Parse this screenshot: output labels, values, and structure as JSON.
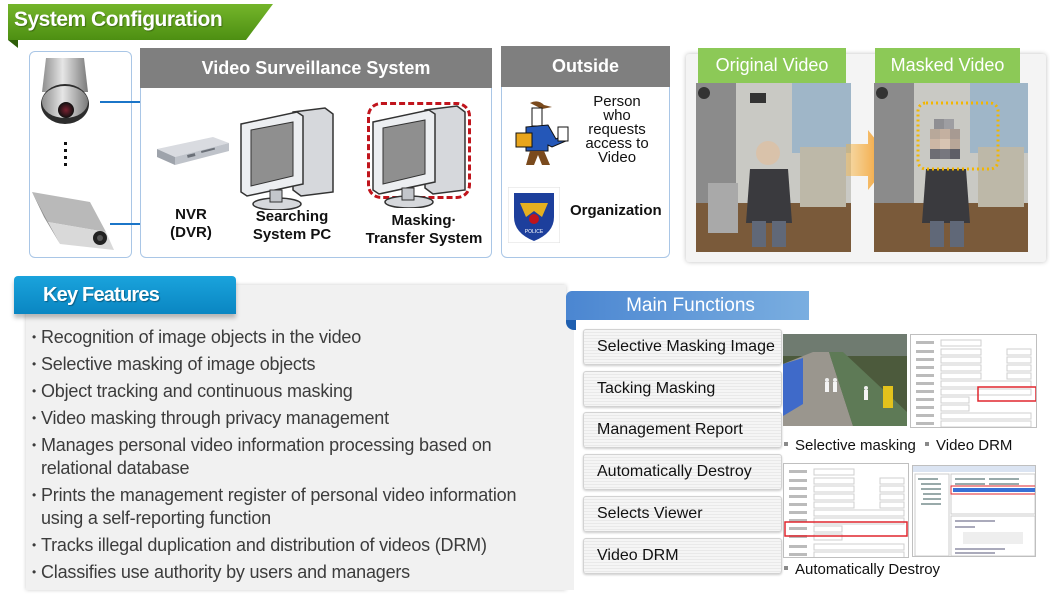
{
  "system_configuration": {
    "title": "System Configuration",
    "video_surveillance_system": {
      "header": "Video Surveillance System",
      "nodes": [
        {
          "icon": "nvr-device-icon",
          "label": "NVR\n(DVR)"
        },
        {
          "icon": "desktop-pc-icon",
          "label": "Searching\nSystem PC"
        },
        {
          "icon": "desktop-pc-icon",
          "label": "Masking·\nTransfer System",
          "highlighted": true
        }
      ]
    },
    "cameras": [
      "dome-camera-icon",
      "bullet-camera-icon"
    ],
    "outside": {
      "header": "Outside",
      "entities": [
        {
          "icon": "person-courier-icon",
          "label": "Person who requests access to Video"
        },
        {
          "icon": "police-badge-icon",
          "label": "Organization",
          "badge_text": "POLICE"
        }
      ]
    },
    "video_comparison": {
      "original_label": "Original Video",
      "masked_label": "Masked Video",
      "arrow_icon": "arrow-right-icon"
    },
    "colors": {
      "banner_green": "#5a9e1a",
      "panel_gray": "#7f7f7f",
      "link_blue": "#1b75c8",
      "highlight_red": "#c0141c",
      "mask_box_orange": "#f2b600",
      "video_tag_green": "#8cc957"
    }
  },
  "key_features": {
    "title": "Key Features",
    "items": [
      "Recognition of image objects in the video",
      "Selective masking of image objects",
      "Object tracking and continuous masking",
      "Video masking through privacy management",
      "Manages personal video information processing based on relational database",
      "Prints the management register of personal video information using a self-reporting function",
      "Tracks illegal duplication and distribution of videos (DRM)",
      "Classifies use authority by users and managers"
    ],
    "colors": {
      "header_blue": "#0f94cf"
    }
  },
  "main_functions": {
    "title": "Main Functions",
    "buttons": [
      "Selective Masking Image",
      "Tacking Masking",
      "Management  Report",
      "Automatically Destroy",
      "Selects Viewer",
      "Video DRM"
    ],
    "captions": {
      "selective_masking": "Selective masking",
      "video_drm": "Video DRM",
      "automatically_destroy": "Automatically Destroy"
    },
    "colors": {
      "header_blue": "#4b86d1"
    }
  }
}
